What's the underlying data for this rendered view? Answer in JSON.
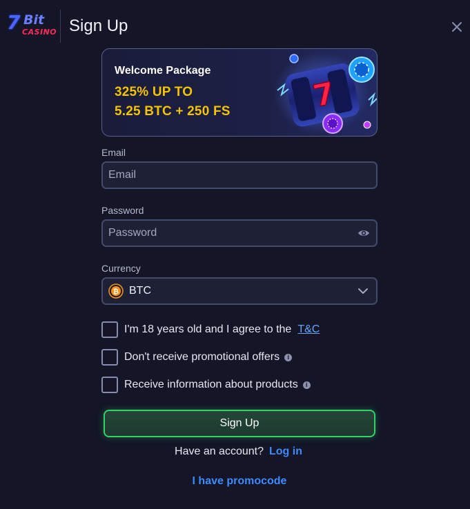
{
  "header": {
    "logo": {
      "seven": "7",
      "bit": "Bit",
      "casino": "CASINO"
    },
    "title": "Sign Up",
    "close_icon": "close-icon"
  },
  "banner": {
    "heading": "Welcome Package",
    "amount_line1": "325% UP TO",
    "amount_line2": "5.25 BTC + 250 FS"
  },
  "form": {
    "email": {
      "label": "Email",
      "placeholder": "Email",
      "value": ""
    },
    "password": {
      "label": "Password",
      "placeholder": "Password",
      "value": "",
      "toggle_icon": "eye-icon"
    },
    "currency": {
      "label": "Currency",
      "selected": "BTC",
      "icon": "bitcoin-icon",
      "dropdown_icon": "chevron-down-icon"
    }
  },
  "checkboxes": {
    "age": {
      "text": "I'm 18 years old and I agree to the",
      "link": "T&C",
      "checked": false
    },
    "promo_opt_out": {
      "text": "Don't receive promotional offers",
      "checked": false
    },
    "product_info": {
      "text": "Receive information about products",
      "checked": false
    }
  },
  "actions": {
    "signup_label": "Sign Up",
    "have_account": "Have an account?",
    "login_label": "Log in",
    "promocode_label": "I have promocode"
  },
  "colors": {
    "background": "#141526",
    "accent_green": "#33d36a",
    "link_blue": "#3d8bff",
    "promo_yellow": "#f5c400",
    "field_border": "#454a6b"
  }
}
